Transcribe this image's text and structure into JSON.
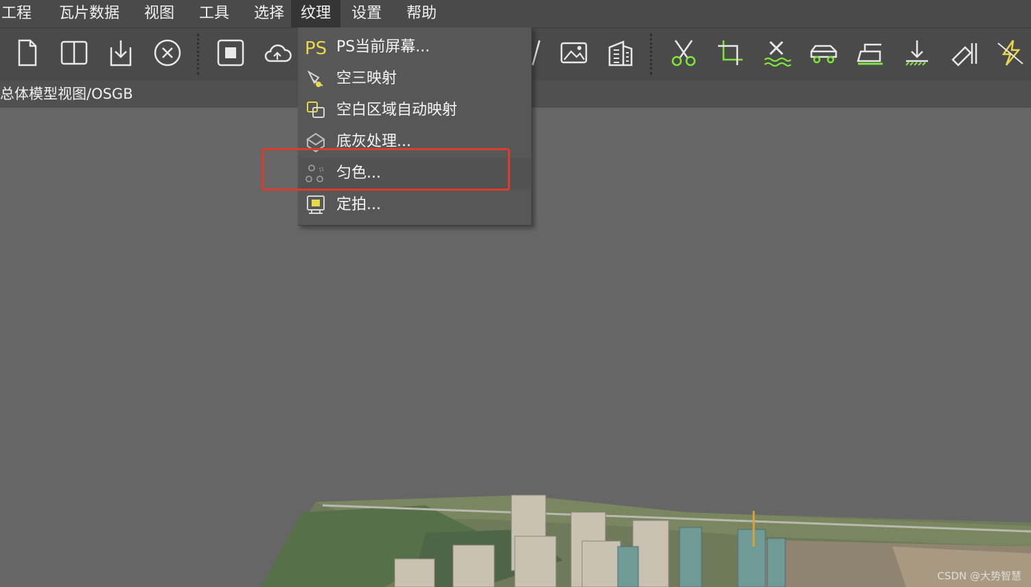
{
  "menubar": {
    "items": [
      {
        "label": "工程"
      },
      {
        "label": "瓦片数据"
      },
      {
        "label": "视图"
      },
      {
        "label": "工具"
      },
      {
        "label": "选择"
      },
      {
        "label": "纹理"
      },
      {
        "label": "设置"
      },
      {
        "label": "帮助"
      }
    ],
    "active_index": 5
  },
  "path_bar": {
    "text": "总体模型视图/OSGB"
  },
  "dropdown": {
    "items": [
      {
        "label": "PS当前屏幕...",
        "icon": "ps-icon"
      },
      {
        "label": "空三映射",
        "icon": "aerotriangulation-icon"
      },
      {
        "label": "空白区域自动映射",
        "icon": "auto-map-icon"
      },
      {
        "label": "底灰处理...",
        "icon": "gray-base-icon"
      },
      {
        "label": "匀色...",
        "icon": "color-balance-icon"
      },
      {
        "label": "定拍...",
        "icon": "fixed-shot-icon"
      }
    ],
    "highlighted_index": 4
  },
  "colors": {
    "accent_green": "#7ee83a",
    "accent_yellow": "#e8d84a",
    "highlight_red": "#e03a2c"
  },
  "watermark": "CSDN @大势智慧"
}
